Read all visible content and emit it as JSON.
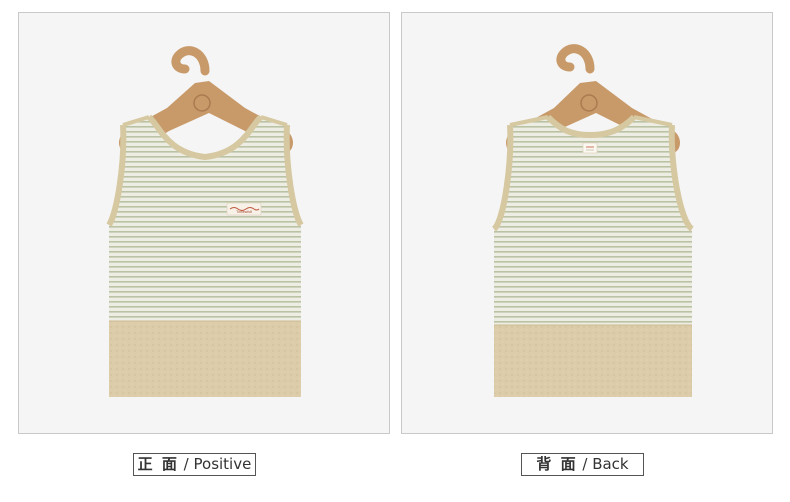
{
  "colors": {
    "background": "#ffffff",
    "panel": "#f5f5f5",
    "panel_border": "#c9c9c9",
    "hanger": "#c89a6a",
    "stripe": "#b9c2a3",
    "body": "#eeede4",
    "trim": "#d6c8a0",
    "hem": "#dccca9"
  },
  "panels": [
    {
      "caption_cn": "正 面",
      "caption_sep": " / ",
      "caption_en": "Positive",
      "view": "front",
      "label_text": "Tinhewildf"
    },
    {
      "caption_cn": "背 面",
      "caption_sep": " / ",
      "caption_en": "Back",
      "view": "back"
    }
  ]
}
